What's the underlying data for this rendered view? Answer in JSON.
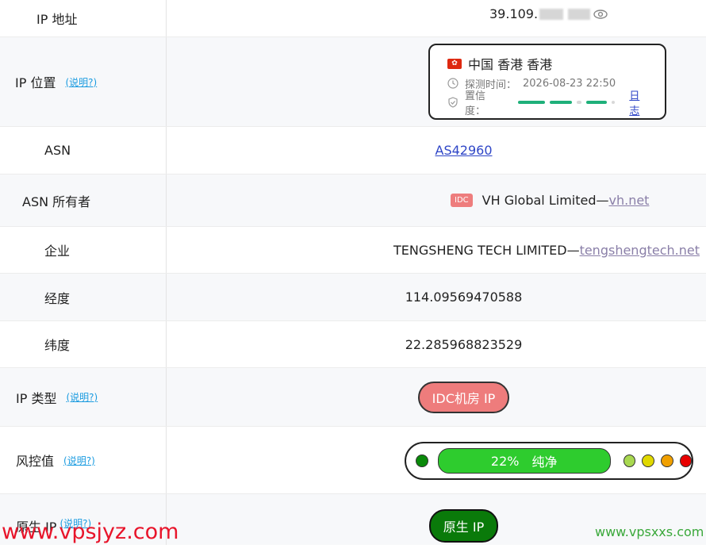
{
  "rows": {
    "ip_address": {
      "label": "IP 地址",
      "value": "39.109."
    },
    "ip_location": {
      "label": "IP 位置",
      "explain": "(说明?)",
      "card": {
        "place": "中国 香港 香港",
        "probe_label": "探测时间：",
        "probe_time": "2026-08-23 22:50",
        "confidence_label": "置信度：",
        "confidence_level": 0.9,
        "log_link": "日志"
      }
    },
    "asn": {
      "label": "ASN",
      "value": "AS42960"
    },
    "asn_owner": {
      "label": "ASN 所有者",
      "tag": "IDC",
      "name": "VH Global Limited— ",
      "link": "vh.net"
    },
    "company": {
      "label": "企业",
      "name": "TENGSHENG TECH LIMITED— ",
      "link": "tengshengtech.net"
    },
    "longitude": {
      "label": "经度",
      "value": "114.09569470588"
    },
    "latitude": {
      "label": "纬度",
      "value": "22.285968823529"
    },
    "ip_type": {
      "label": "IP 类型",
      "explain": "(说明?)",
      "value": "IDC机房 IP"
    },
    "risk": {
      "label": "风控值",
      "explain": "(说明?)",
      "percent": "22%",
      "status": "纯净",
      "colors": {
        "left": "#0a8a0a",
        "main": "#2ecc2e",
        "d1": "#a8d850",
        "d2": "#e0d800",
        "d3": "#f0a000",
        "d4": "#e80000"
      }
    },
    "native_ip": {
      "label": "原生 IP",
      "explain": "(说明?)",
      "value": "原生 IP"
    }
  },
  "watermarks": {
    "left": "www.vpsjyz.com",
    "right": "www.vpsxxs.com"
  }
}
